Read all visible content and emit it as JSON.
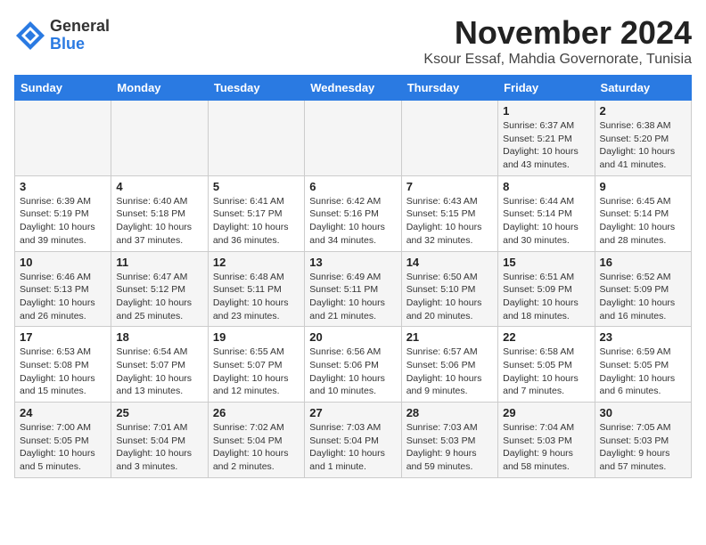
{
  "header": {
    "logo_line1": "General",
    "logo_line2": "Blue",
    "month": "November 2024",
    "location": "Ksour Essaf, Mahdia Governorate, Tunisia"
  },
  "weekdays": [
    "Sunday",
    "Monday",
    "Tuesday",
    "Wednesday",
    "Thursday",
    "Friday",
    "Saturday"
  ],
  "weeks": [
    [
      {
        "day": "",
        "info": ""
      },
      {
        "day": "",
        "info": ""
      },
      {
        "day": "",
        "info": ""
      },
      {
        "day": "",
        "info": ""
      },
      {
        "day": "",
        "info": ""
      },
      {
        "day": "1",
        "info": "Sunrise: 6:37 AM\nSunset: 5:21 PM\nDaylight: 10 hours and 43 minutes."
      },
      {
        "day": "2",
        "info": "Sunrise: 6:38 AM\nSunset: 5:20 PM\nDaylight: 10 hours and 41 minutes."
      }
    ],
    [
      {
        "day": "3",
        "info": "Sunrise: 6:39 AM\nSunset: 5:19 PM\nDaylight: 10 hours and 39 minutes."
      },
      {
        "day": "4",
        "info": "Sunrise: 6:40 AM\nSunset: 5:18 PM\nDaylight: 10 hours and 37 minutes."
      },
      {
        "day": "5",
        "info": "Sunrise: 6:41 AM\nSunset: 5:17 PM\nDaylight: 10 hours and 36 minutes."
      },
      {
        "day": "6",
        "info": "Sunrise: 6:42 AM\nSunset: 5:16 PM\nDaylight: 10 hours and 34 minutes."
      },
      {
        "day": "7",
        "info": "Sunrise: 6:43 AM\nSunset: 5:15 PM\nDaylight: 10 hours and 32 minutes."
      },
      {
        "day": "8",
        "info": "Sunrise: 6:44 AM\nSunset: 5:14 PM\nDaylight: 10 hours and 30 minutes."
      },
      {
        "day": "9",
        "info": "Sunrise: 6:45 AM\nSunset: 5:14 PM\nDaylight: 10 hours and 28 minutes."
      }
    ],
    [
      {
        "day": "10",
        "info": "Sunrise: 6:46 AM\nSunset: 5:13 PM\nDaylight: 10 hours and 26 minutes."
      },
      {
        "day": "11",
        "info": "Sunrise: 6:47 AM\nSunset: 5:12 PM\nDaylight: 10 hours and 25 minutes."
      },
      {
        "day": "12",
        "info": "Sunrise: 6:48 AM\nSunset: 5:11 PM\nDaylight: 10 hours and 23 minutes."
      },
      {
        "day": "13",
        "info": "Sunrise: 6:49 AM\nSunset: 5:11 PM\nDaylight: 10 hours and 21 minutes."
      },
      {
        "day": "14",
        "info": "Sunrise: 6:50 AM\nSunset: 5:10 PM\nDaylight: 10 hours and 20 minutes."
      },
      {
        "day": "15",
        "info": "Sunrise: 6:51 AM\nSunset: 5:09 PM\nDaylight: 10 hours and 18 minutes."
      },
      {
        "day": "16",
        "info": "Sunrise: 6:52 AM\nSunset: 5:09 PM\nDaylight: 10 hours and 16 minutes."
      }
    ],
    [
      {
        "day": "17",
        "info": "Sunrise: 6:53 AM\nSunset: 5:08 PM\nDaylight: 10 hours and 15 minutes."
      },
      {
        "day": "18",
        "info": "Sunrise: 6:54 AM\nSunset: 5:07 PM\nDaylight: 10 hours and 13 minutes."
      },
      {
        "day": "19",
        "info": "Sunrise: 6:55 AM\nSunset: 5:07 PM\nDaylight: 10 hours and 12 minutes."
      },
      {
        "day": "20",
        "info": "Sunrise: 6:56 AM\nSunset: 5:06 PM\nDaylight: 10 hours and 10 minutes."
      },
      {
        "day": "21",
        "info": "Sunrise: 6:57 AM\nSunset: 5:06 PM\nDaylight: 10 hours and 9 minutes."
      },
      {
        "day": "22",
        "info": "Sunrise: 6:58 AM\nSunset: 5:05 PM\nDaylight: 10 hours and 7 minutes."
      },
      {
        "day": "23",
        "info": "Sunrise: 6:59 AM\nSunset: 5:05 PM\nDaylight: 10 hours and 6 minutes."
      }
    ],
    [
      {
        "day": "24",
        "info": "Sunrise: 7:00 AM\nSunset: 5:05 PM\nDaylight: 10 hours and 5 minutes."
      },
      {
        "day": "25",
        "info": "Sunrise: 7:01 AM\nSunset: 5:04 PM\nDaylight: 10 hours and 3 minutes."
      },
      {
        "day": "26",
        "info": "Sunrise: 7:02 AM\nSunset: 5:04 PM\nDaylight: 10 hours and 2 minutes."
      },
      {
        "day": "27",
        "info": "Sunrise: 7:03 AM\nSunset: 5:04 PM\nDaylight: 10 hours and 1 minute."
      },
      {
        "day": "28",
        "info": "Sunrise: 7:03 AM\nSunset: 5:03 PM\nDaylight: 9 hours and 59 minutes."
      },
      {
        "day": "29",
        "info": "Sunrise: 7:04 AM\nSunset: 5:03 PM\nDaylight: 9 hours and 58 minutes."
      },
      {
        "day": "30",
        "info": "Sunrise: 7:05 AM\nSunset: 5:03 PM\nDaylight: 9 hours and 57 minutes."
      }
    ]
  ]
}
